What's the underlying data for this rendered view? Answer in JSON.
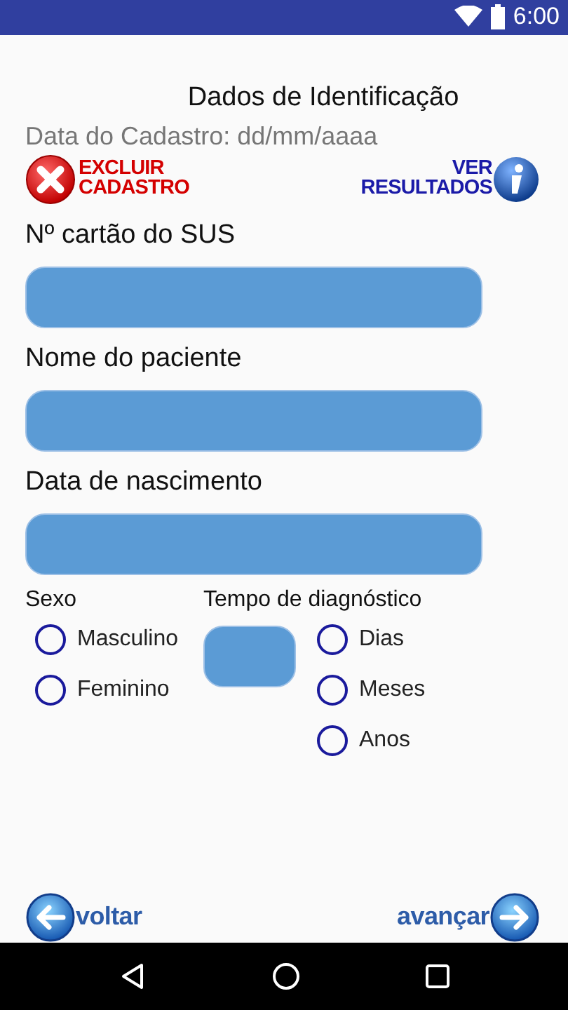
{
  "status_bar": {
    "time": "6:00"
  },
  "title": "Dados de Identificação",
  "date_label": "Data do Cadastro: dd/mm/aaaa",
  "actions": [
    {
      "kind": "delete",
      "lines": [
        "EXCLUIR",
        "CADASTRO"
      ]
    },
    {
      "kind": "info",
      "lines": [
        "VER",
        "RESULTADOS"
      ]
    }
  ],
  "fields": [
    {
      "label": "Nº cartão do SUS"
    },
    {
      "label": "Nome do paciente"
    },
    {
      "label": "Data de nascimento"
    }
  ],
  "sex": {
    "label": "Sexo",
    "options": [
      {
        "label": "Masculino",
        "selected": false
      },
      {
        "label": "Feminino",
        "selected": false
      }
    ]
  },
  "diagnosis_time": {
    "label": "Tempo de diagnóstico",
    "units": [
      {
        "label": "Dias",
        "selected": false
      },
      {
        "label": "Meses",
        "selected": false
      },
      {
        "label": "Anos",
        "selected": false
      }
    ]
  },
  "nav": [
    {
      "kind": "back",
      "label": "voltar"
    },
    {
      "kind": "next",
      "label": "avançar"
    }
  ]
}
